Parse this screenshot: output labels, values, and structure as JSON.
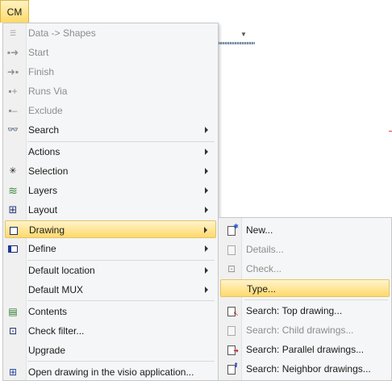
{
  "menubar": {
    "cm_label": "CM"
  },
  "main_menu": {
    "items": [
      {
        "label": "Data -> Shapes",
        "icon": "data-shapes-icon",
        "disabled": true,
        "submenu": false
      },
      {
        "label": "Start",
        "icon": "start-arrow-icon",
        "disabled": true,
        "submenu": false
      },
      {
        "label": "Finish",
        "icon": "finish-arrow-icon",
        "disabled": true,
        "submenu": false
      },
      {
        "label": "Runs Via",
        "icon": "runs-via-icon",
        "disabled": true,
        "submenu": false
      },
      {
        "label": "Exclude",
        "icon": "exclude-icon",
        "disabled": true,
        "submenu": false
      },
      {
        "label": "Search",
        "icon": "binoculars-icon",
        "disabled": false,
        "submenu": true
      },
      {
        "label": "Actions",
        "icon": "",
        "disabled": false,
        "submenu": true
      },
      {
        "label": "Selection",
        "icon": "selection-icon",
        "disabled": false,
        "submenu": true
      },
      {
        "label": "Layers",
        "icon": "layers-icon",
        "disabled": false,
        "submenu": true
      },
      {
        "label": "Layout",
        "icon": "layout-icon",
        "disabled": false,
        "submenu": true
      },
      {
        "label": "Drawing",
        "icon": "drawing-icon",
        "disabled": false,
        "submenu": true,
        "highlighted": true
      },
      {
        "label": "Define",
        "icon": "define-icon",
        "disabled": false,
        "submenu": true
      },
      {
        "label": "Default location",
        "icon": "",
        "disabled": false,
        "submenu": true
      },
      {
        "label": "Default MUX",
        "icon": "",
        "disabled": false,
        "submenu": true
      },
      {
        "label": "Contents",
        "icon": "contents-icon",
        "disabled": false,
        "submenu": false
      },
      {
        "label": "Check filter...",
        "icon": "check-filter-icon",
        "disabled": false,
        "submenu": false
      },
      {
        "label": "Upgrade",
        "icon": "",
        "disabled": false,
        "submenu": false
      },
      {
        "label": "Open drawing in the visio application...",
        "icon": "visio-icon",
        "disabled": false,
        "submenu": false
      }
    ]
  },
  "drawing_submenu": {
    "items": [
      {
        "label": "New...",
        "icon": "new-drawing-icon",
        "disabled": false
      },
      {
        "label": "Details...",
        "icon": "details-icon",
        "disabled": true
      },
      {
        "label": "Check...",
        "icon": "check-icon",
        "disabled": true
      },
      {
        "label": "Type...",
        "icon": "",
        "disabled": false,
        "highlighted": true
      },
      {
        "label": "Search: Top drawing...",
        "icon": "top-drawing-icon",
        "disabled": false
      },
      {
        "label": "Search: Child drawings...",
        "icon": "child-drawings-icon",
        "disabled": true
      },
      {
        "label": "Search: Parallel drawings...",
        "icon": "parallel-drawings-icon",
        "disabled": false
      },
      {
        "label": "Search: Neighbor drawings...",
        "icon": "neighbor-drawings-icon",
        "disabled": false
      }
    ]
  },
  "colors": {
    "highlight_top": "#fff4cc",
    "highlight_bottom": "#ffd96b",
    "menu_bg": "#f5f6f7",
    "disabled_text": "#8d8d8d"
  }
}
